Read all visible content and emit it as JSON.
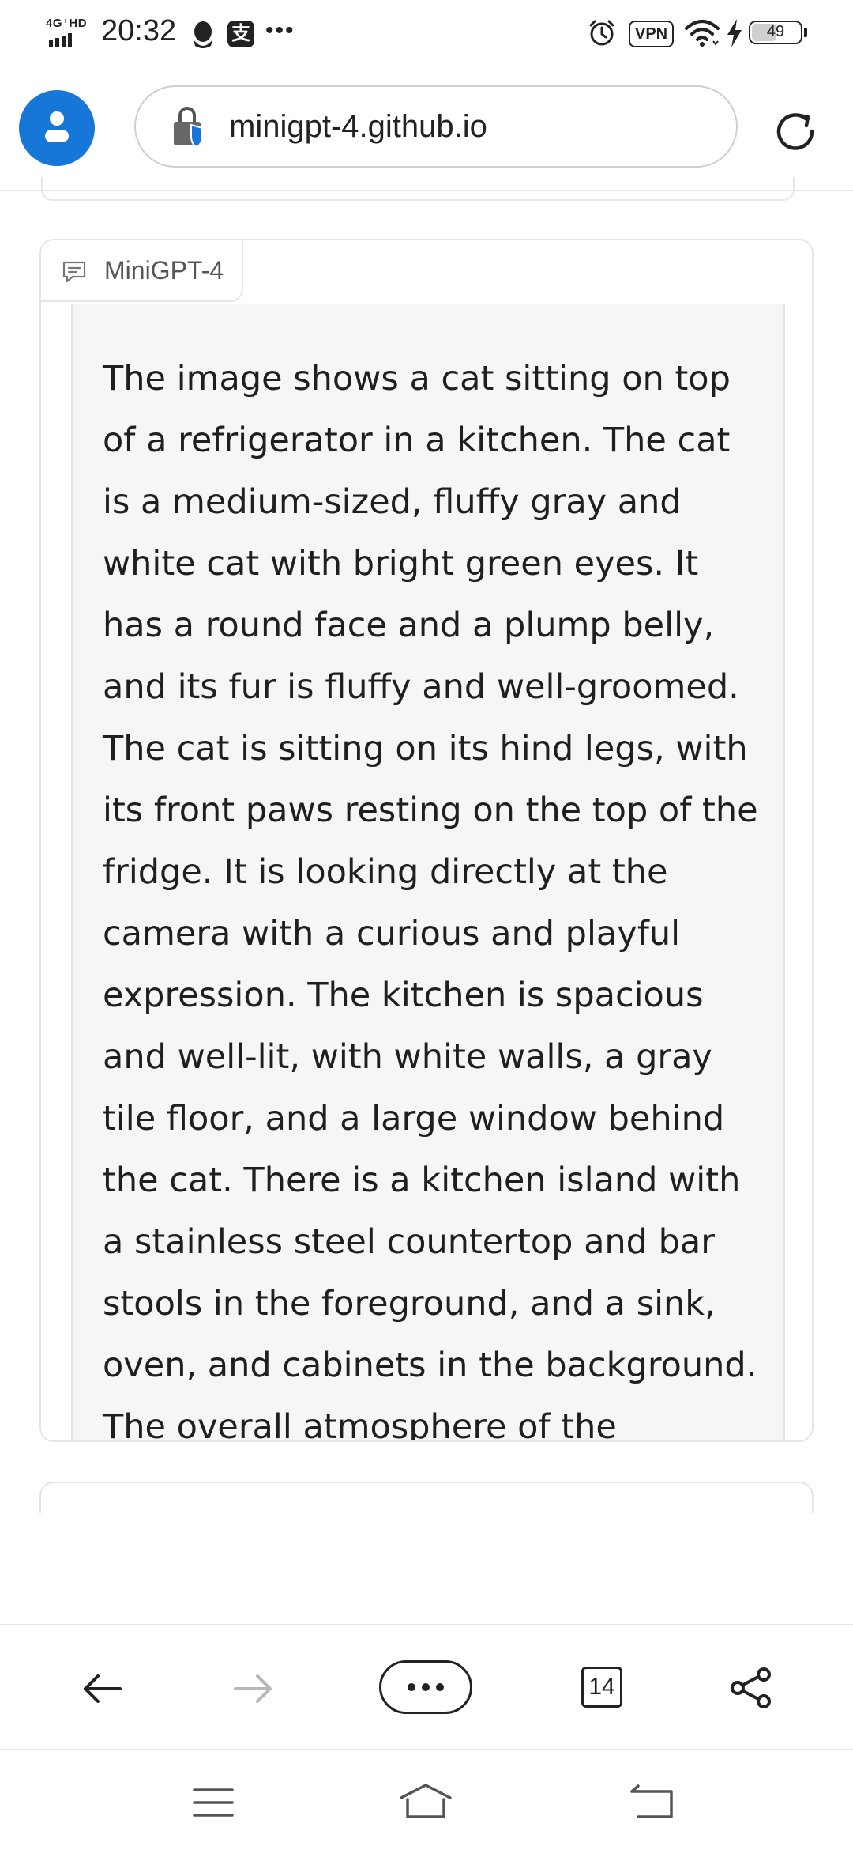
{
  "status_bar": {
    "network": "4G⁺HD",
    "time": "20:32",
    "vpn_label": "VPN",
    "battery_level": "49",
    "battery_fraction": 0.49,
    "icons": [
      "signal-icon",
      "qq-icon",
      "alipay-icon",
      "more-icon",
      "alarm-icon",
      "wifi-icon",
      "charging-icon",
      "battery-icon"
    ]
  },
  "browser": {
    "url": "minigpt-4.github.io",
    "tab_count": "14",
    "accent_color": "#1677d9"
  },
  "chat": {
    "sender": "MiniGPT-4",
    "message": "The image shows a cat sitting on top of a refrigerator in a kitchen. The cat is a medium-sized, fluffy gray and white cat with bright green eyes. It has a round face and a plump belly, and its fur is fluffy and well-groomed. The cat is sitting on its hind legs, with its front paws resting on the top of the fridge. It is looking directly at the camera with a curious and playful expression. The kitchen is spacious and well-lit, with white walls, a gray tile floor, and a large window behind the cat. There is a kitchen island with a stainless steel countertop and bar stools in the foreground, and a sink, oven, and cabinets in the background. The overall atmosphere of the"
  }
}
